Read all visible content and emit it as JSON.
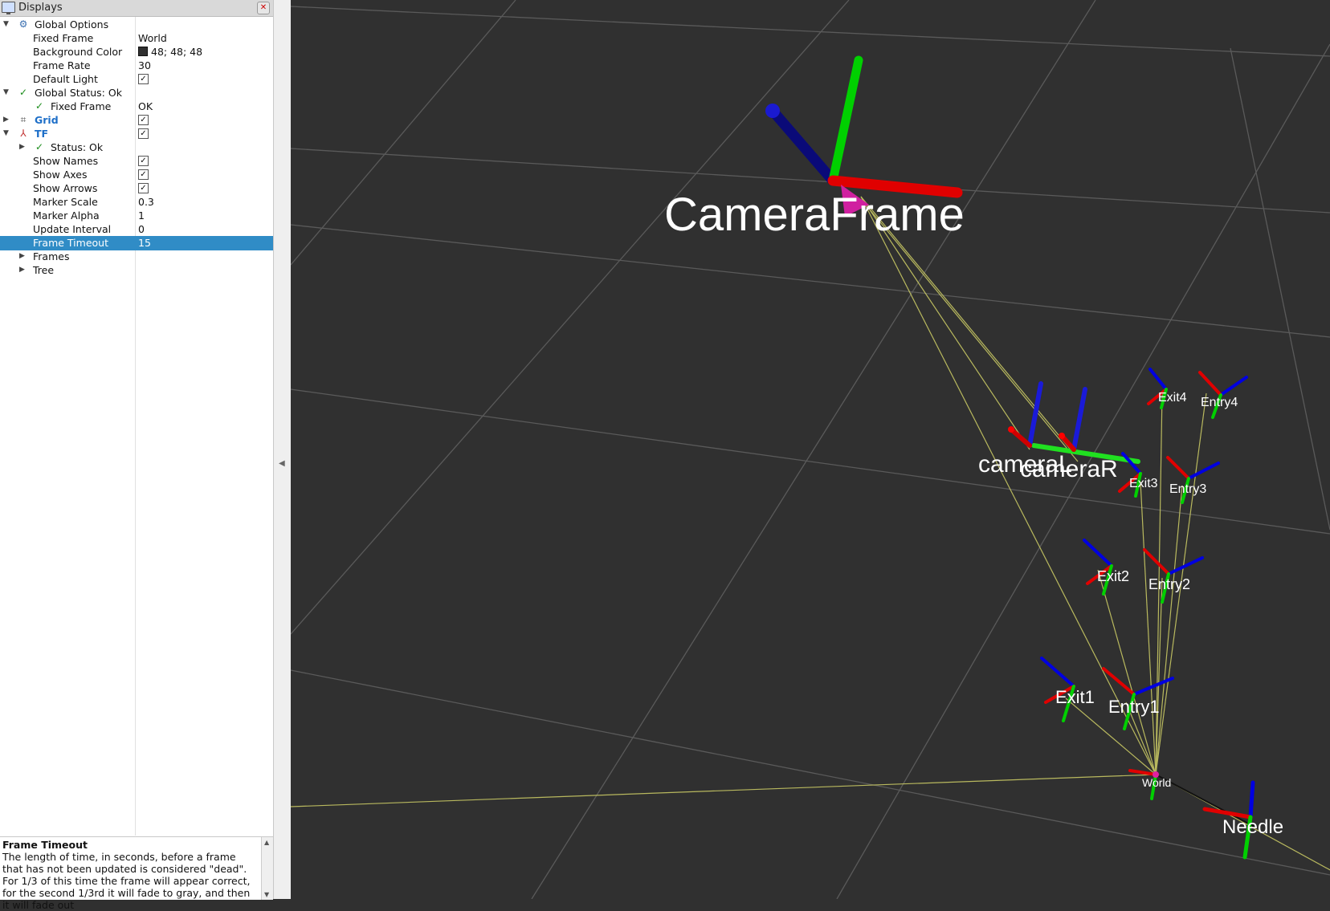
{
  "panel": {
    "title": "Displays",
    "rows": [
      {
        "name": "Global Options",
        "value": ""
      },
      {
        "name": "Fixed Frame",
        "value": "World"
      },
      {
        "name": "Background Color",
        "value": "48; 48; 48"
      },
      {
        "name": "Frame Rate",
        "value": "30"
      },
      {
        "name": "Default Light",
        "value": "✓"
      },
      {
        "name": "Global Status: Ok",
        "value": ""
      },
      {
        "name": "Fixed Frame",
        "value": "OK"
      },
      {
        "name": "Grid",
        "value": "✓"
      },
      {
        "name": "TF",
        "value": "✓"
      },
      {
        "name": "Status: Ok",
        "value": ""
      },
      {
        "name": "Show Names",
        "value": "✓"
      },
      {
        "name": "Show Axes",
        "value": "✓"
      },
      {
        "name": "Show Arrows",
        "value": "✓"
      },
      {
        "name": "Marker Scale",
        "value": "0.3"
      },
      {
        "name": "Marker Alpha",
        "value": "1"
      },
      {
        "name": "Update Interval",
        "value": "0"
      },
      {
        "name": "Frame Timeout",
        "value": "15"
      },
      {
        "name": "Frames",
        "value": ""
      },
      {
        "name": "Tree",
        "value": ""
      }
    ],
    "description": {
      "title": "Frame Timeout",
      "body": "The length of time, in seconds, before a frame that has not been updated is considered \"dead\". For 1/3 of this time the frame will appear correct, for the second 1/3rd it will fade to gray, and then it will fade out"
    }
  },
  "scene": {
    "background_color": "#303030",
    "frame_labels": {
      "camera_frame": "CameraFrame",
      "camera_l": "cameraL",
      "camera_r": "cameraR",
      "exit4": "Exit4",
      "entry4": "Entry4",
      "exit3": "Exit3",
      "entry3": "Entry3",
      "exit2": "Exit2",
      "entry2": "Entry2",
      "exit1": "Exit1",
      "entry1": "Entry1",
      "world": "World",
      "needle": "Needle"
    },
    "colors": {
      "x_axis": "#ff0000",
      "y_axis": "#00e000",
      "z_axis": "#0000e0",
      "link": "#c8c864",
      "selection": "#308cc6"
    }
  }
}
